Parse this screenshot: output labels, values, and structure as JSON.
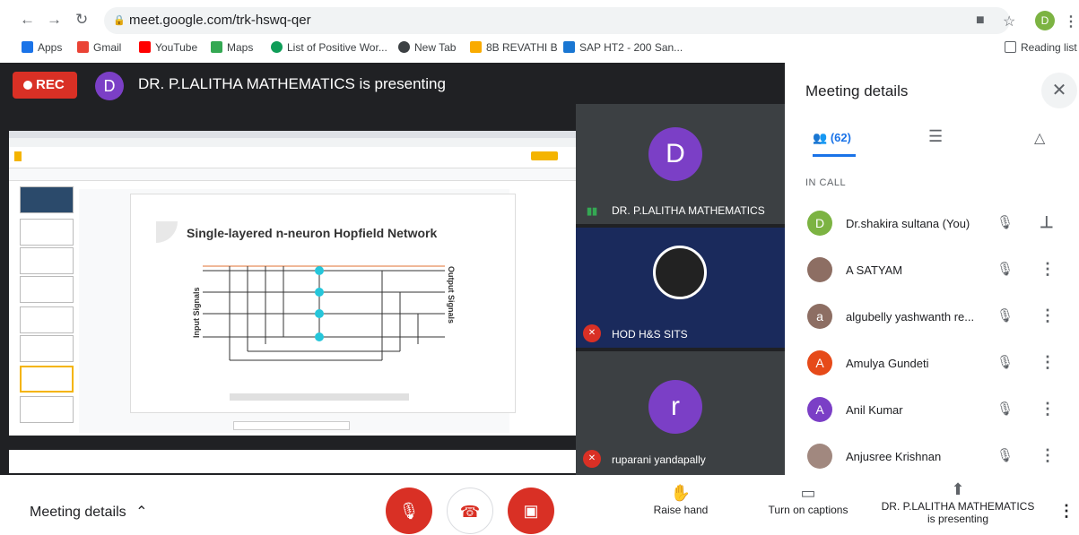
{
  "browser": {
    "url": "meet.google.com/trk-hswq-qer",
    "profile_initial": "D",
    "bookmarks": [
      "Apps",
      "Gmail",
      "YouTube",
      "Maps",
      "List of Positive Wor...",
      "New Tab",
      "8B REVATHI B",
      "SAP HT2 - 200 San..."
    ],
    "reading_list": "Reading list"
  },
  "stage": {
    "rec_label": "REC",
    "presenter_initial": "D",
    "presenter_text": "DR. P.LALITHA MATHEMATICS is presenting",
    "slide_title": "Single-layered n-neuron Hopfield Network",
    "axis_left": "Input Signals",
    "axis_right": "Output Signals"
  },
  "tiles": [
    {
      "name": "DR. P.LALITHA MATHEMATICS",
      "initial": "D"
    },
    {
      "name": "HOD H&S SITS"
    },
    {
      "name": "ruparani yandapally",
      "initial": "r"
    }
  ],
  "panel": {
    "title": "Meeting details",
    "people_count": "(62)",
    "section": "IN CALL",
    "people": [
      {
        "initial": "D",
        "name": "Dr.shakira sultana (You)",
        "color": "#7cb342"
      },
      {
        "initial": "",
        "name": "A SATYAM",
        "color": "#8d6e63"
      },
      {
        "initial": "a",
        "name": "algubelly yashwanth re...",
        "color": "#8d6e63"
      },
      {
        "initial": "A",
        "name": "Amulya Gundeti",
        "color": "#e64a19"
      },
      {
        "initial": "A",
        "name": "Anil Kumar",
        "color": "#7b3fc6"
      },
      {
        "initial": "",
        "name": "Anjusree Krishnan",
        "color": "#a1887f"
      }
    ]
  },
  "bottom": {
    "meeting_details": "Meeting details",
    "raise_hand": "Raise hand",
    "captions": "Turn on captions",
    "presenting_line1": "DR. P.LALITHA MATHEMATICS",
    "presenting_line2": "is presenting"
  }
}
